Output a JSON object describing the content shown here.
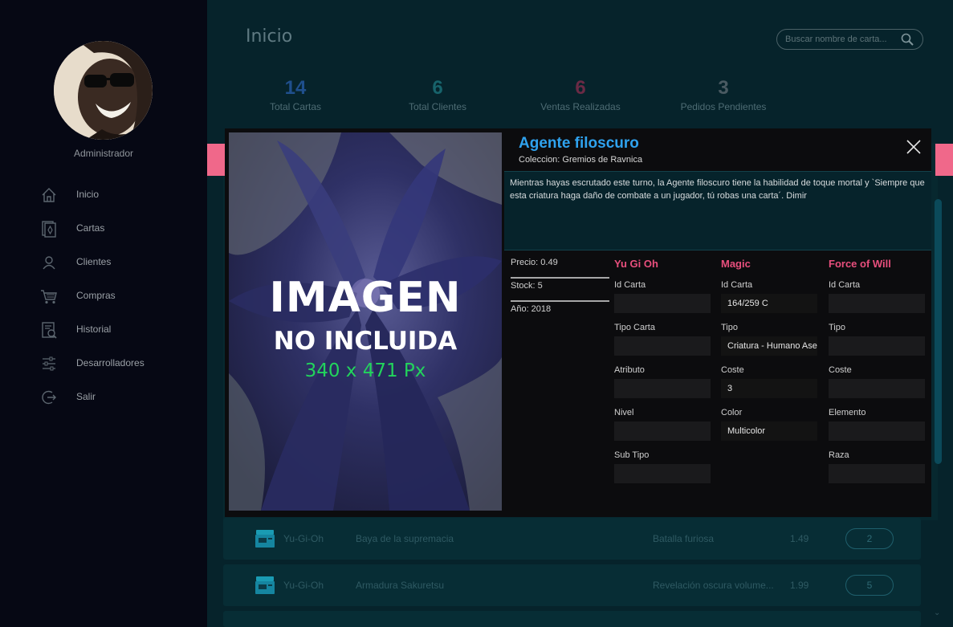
{
  "sidebar": {
    "username": "Administrador",
    "nav": [
      {
        "label": "Inicio",
        "icon": "home-icon"
      },
      {
        "label": "Cartas",
        "icon": "cards-icon"
      },
      {
        "label": "Clientes",
        "icon": "user-icon"
      },
      {
        "label": "Compras",
        "icon": "cart-icon"
      },
      {
        "label": "Historial",
        "icon": "history-icon"
      },
      {
        "label": "Desarrolladores",
        "icon": "sliders-icon"
      },
      {
        "label": "Salir",
        "icon": "logout-icon"
      }
    ]
  },
  "header": {
    "title": "Inicio",
    "search_placeholder": "Buscar nombre de carta...",
    "search_icon": "search-icon"
  },
  "stats": [
    {
      "value": "14",
      "label": "Total Cartas",
      "color": "#1f4f8c"
    },
    {
      "value": "6",
      "label": "Total Clientes",
      "color": "#17636b"
    },
    {
      "value": "6",
      "label": "Ventas Realizadas",
      "color": "#6a2a45"
    },
    {
      "value": "3",
      "label": "Pedidos Pendientes",
      "color": "#4a5a62"
    }
  ],
  "list": [
    {
      "game": "Yu-Gi-Oh",
      "name": "Baya de la supremacia",
      "collection": "Batalla furiosa",
      "price": "1.49",
      "qty": "2"
    },
    {
      "game": "Yu-Gi-Oh",
      "name": "Armadura Sakuretsu",
      "collection": "Revelación oscura volume...",
      "price": "1.99",
      "qty": "5"
    }
  ],
  "modal": {
    "title": "Agente filoscuro",
    "subtitle": "Coleccion: Gremios de Ravnica",
    "description": "Mientras hayas escrutado este turno, la Agente filoscuro tiene la habilidad de toque mortal y `Siempre que esta criatura haga daño de combate a un jugador, tú robas una carta´. Dimir",
    "image": {
      "line1": "IMAGEN",
      "line2": "NO INCLUIDA",
      "line3": "340 x 471 Px"
    },
    "info": {
      "precio": "Precio: 0.49",
      "stock": "Stock: 5",
      "anio": "Año: 2018"
    },
    "yugioh": {
      "header": "Yu Gi Oh",
      "fields": [
        {
          "label": "Id Carta",
          "value": ""
        },
        {
          "label": "Tipo Carta",
          "value": ""
        },
        {
          "label": "Atributo",
          "value": ""
        },
        {
          "label": "Nivel",
          "value": ""
        },
        {
          "label": "Sub Tipo",
          "value": ""
        }
      ]
    },
    "magic": {
      "header": "Magic",
      "fields": [
        {
          "label": "Id Carta",
          "value": "164/259 C"
        },
        {
          "label": "Tipo",
          "value": "Criatura - Humano Asesino"
        },
        {
          "label": "Coste",
          "value": "3"
        },
        {
          "label": "Color",
          "value": "Multicolor"
        }
      ]
    },
    "fow": {
      "header": "Force of Will",
      "fields": [
        {
          "label": "Id Carta",
          "value": ""
        },
        {
          "label": "Tipo",
          "value": ""
        },
        {
          "label": "Coste",
          "value": ""
        },
        {
          "label": "Elemento",
          "value": ""
        },
        {
          "label": "Raza",
          "value": ""
        }
      ]
    }
  }
}
